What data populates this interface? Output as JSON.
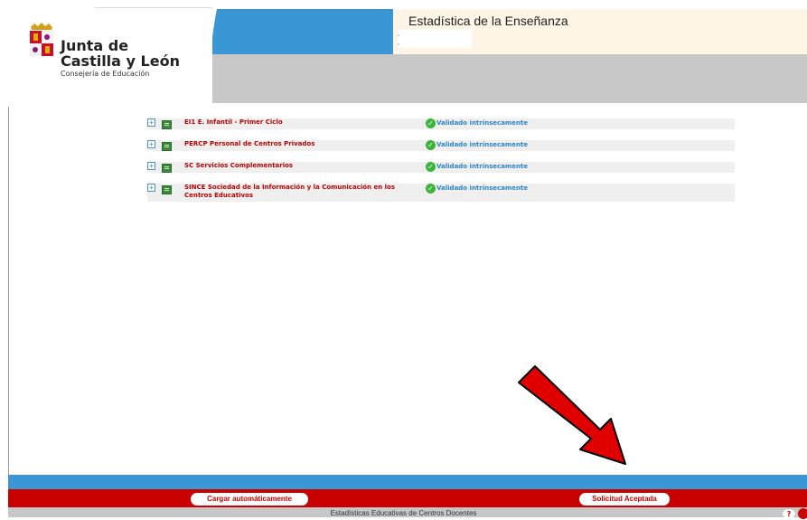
{
  "header": {
    "brand_line1": "Junta de",
    "brand_line2": "Castilla y León",
    "brand_sub": "Consejería de Educación",
    "app_title": "Estadística de la Enseñanza"
  },
  "rows": [
    {
      "name": "EI1 E. Infantil - Primer Ciclo",
      "status": "Validado intrínsecamente"
    },
    {
      "name": "PERCP Personal de Centros Privados",
      "status": "Validado intrínsecamente"
    },
    {
      "name": "SC Servicios Complementarios",
      "status": "Validado intrínsecamente"
    },
    {
      "name": "SINCE Sociedad de la Información y la Comunicación en los Centros Educativos",
      "status": "Validado intrínsecamente"
    }
  ],
  "footer": {
    "cargar_label": "Cargar automáticamente",
    "solicitud_label": "Solicitud Aceptada",
    "help_label": "?",
    "bottom_text": "Estadísticas Educativas de Centros Docentes"
  },
  "colors": {
    "brand_red": "#c80000",
    "header_blue": "#3a96d4",
    "status_blue": "#2f84c4",
    "status_green": "#3cb43c",
    "header_cream": "#fef5e6",
    "header_gray": "#c7c7c7"
  },
  "icons": {
    "expand": "expand-plus-icon",
    "document": "document-icon",
    "status": "check-circle-icon",
    "annotation": "red-arrow-annotation"
  }
}
